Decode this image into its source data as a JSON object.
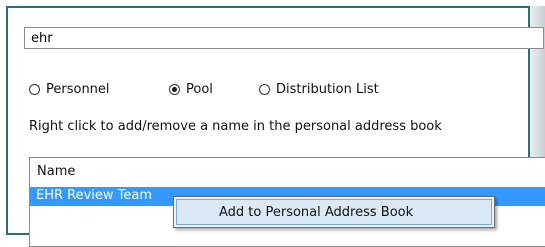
{
  "search": {
    "value": "ehr"
  },
  "type_options": [
    {
      "label": "Personnel",
      "checked": false
    },
    {
      "label": "Pool",
      "checked": true
    },
    {
      "label": "Distribution List",
      "checked": false
    }
  ],
  "instruction": "Right click to add/remove a name in the personal address book",
  "results": {
    "column_header": "Name",
    "rows": [
      {
        "name": "EHR Review Team",
        "selected": true
      }
    ]
  },
  "context_menu": {
    "items": [
      "Add to Personal Address Book"
    ]
  },
  "colors": {
    "selection": "#3399ff",
    "frame_border": "#2e6e6e",
    "menu_highlight": "#dbe8f6"
  }
}
